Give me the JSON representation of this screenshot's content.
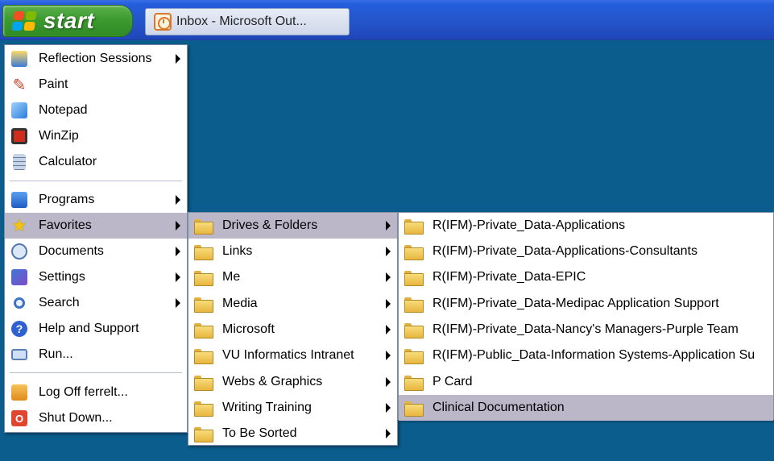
{
  "taskbar": {
    "start_label": "start",
    "task_button_label": "Inbox - Microsoft Out..."
  },
  "start_menu": {
    "pinned": [
      {
        "label": "Reflection Sessions",
        "icon": "reflection-icon",
        "submenu": true
      },
      {
        "label": "Paint",
        "icon": "paint-icon",
        "submenu": false
      },
      {
        "label": "Notepad",
        "icon": "notepad-icon",
        "submenu": false
      },
      {
        "label": "WinZip",
        "icon": "winzip-icon",
        "submenu": false
      },
      {
        "label": "Calculator",
        "icon": "calculator-icon",
        "submenu": false
      }
    ],
    "main": [
      {
        "label": "Programs",
        "icon": "programs-icon",
        "submenu": true
      },
      {
        "label": "Favorites",
        "icon": "star-icon",
        "submenu": true,
        "selected": true
      },
      {
        "label": "Documents",
        "icon": "documents-icon",
        "submenu": true
      },
      {
        "label": "Settings",
        "icon": "settings-icon",
        "submenu": true
      },
      {
        "label": "Search",
        "icon": "search-icon",
        "submenu": true
      },
      {
        "label": "Help and Support",
        "icon": "help-icon",
        "submenu": false
      },
      {
        "label": "Run...",
        "icon": "run-icon",
        "submenu": false
      }
    ],
    "bottom": [
      {
        "label": "Log Off ferrelt...",
        "icon": "logoff-icon"
      },
      {
        "label": "Shut Down...",
        "icon": "shutdown-icon"
      }
    ]
  },
  "favorites_menu": {
    "items": [
      {
        "label": "Drives & Folders",
        "submenu": true,
        "selected": true
      },
      {
        "label": "Links",
        "submenu": true
      },
      {
        "label": "Me",
        "submenu": true
      },
      {
        "label": "Media",
        "submenu": true
      },
      {
        "label": "Microsoft",
        "submenu": true
      },
      {
        "label": "VU Informatics Intranet",
        "submenu": true
      },
      {
        "label": "Webs & Graphics",
        "submenu": true
      },
      {
        "label": "Writing Training",
        "submenu": true
      },
      {
        "label": "To Be Sorted",
        "submenu": true
      }
    ]
  },
  "drives_menu": {
    "items": [
      {
        "label": "R(IFM)-Private_Data-Applications"
      },
      {
        "label": "R(IFM)-Private_Data-Applications-Consultants"
      },
      {
        "label": "R(IFM)-Private_Data-EPIC"
      },
      {
        "label": "R(IFM)-Private_Data-Medipac Application Support"
      },
      {
        "label": "R(IFM)-Private_Data-Nancy's Managers-Purple Team"
      },
      {
        "label": "R(IFM)-Public_Data-Information Systems-Application Su"
      },
      {
        "label": "P Card"
      },
      {
        "label": "Clinical Documentation",
        "selected": true
      }
    ]
  },
  "colors": {
    "desktop": "#0a5d8c",
    "taskbar": "#245edb",
    "start_button": "#3c9b2f",
    "highlight": "#bbb7c9"
  }
}
